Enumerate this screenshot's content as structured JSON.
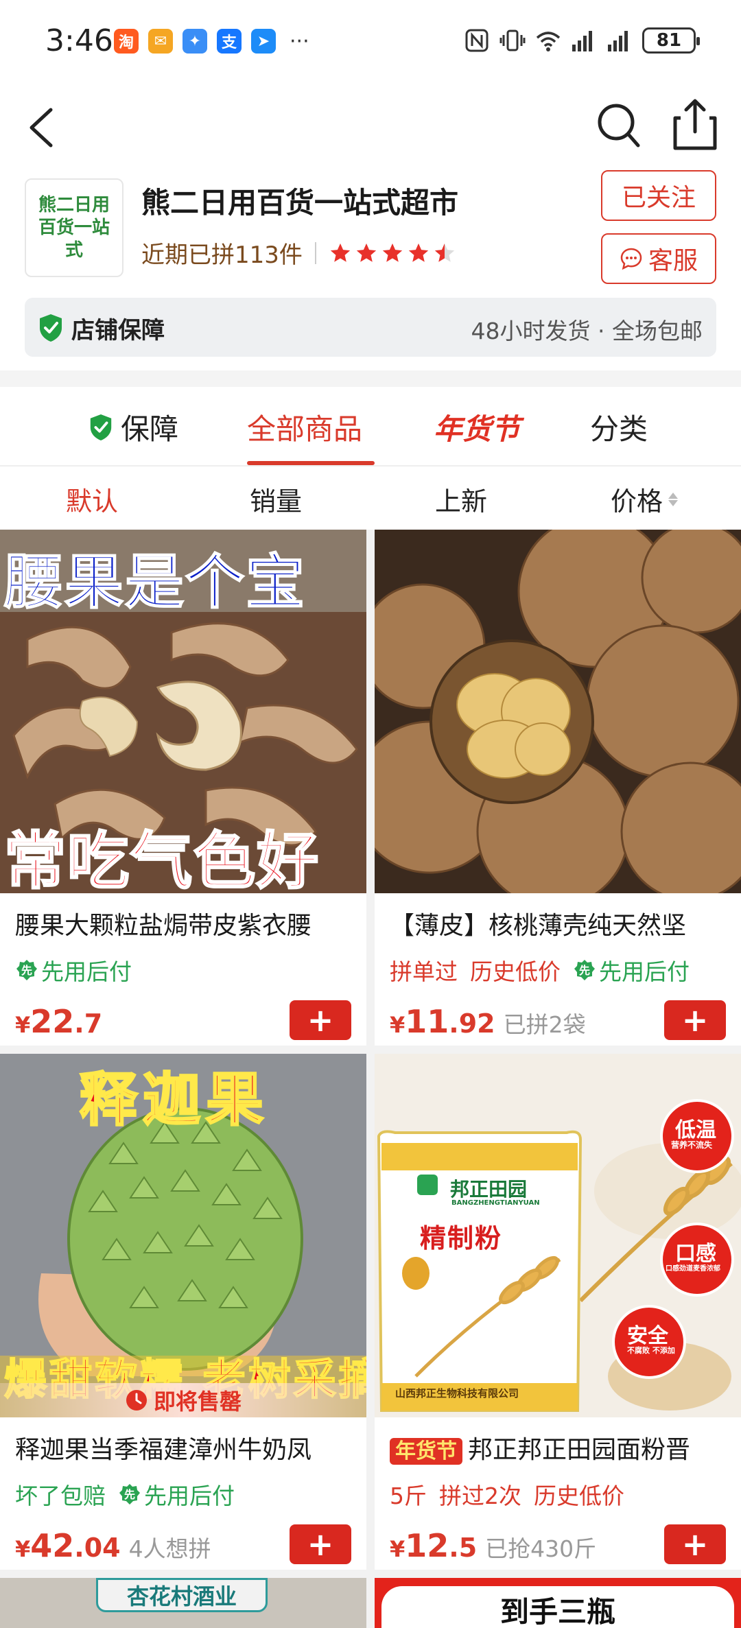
{
  "status_bar": {
    "time": "3:46",
    "more": "···",
    "battery": "81",
    "apps": [
      {
        "icon": "taobao-app-icon",
        "label": "淘",
        "color": "#ff5a1f"
      },
      {
        "icon": "mail-app-icon",
        "label": "✉",
        "color": "#f5a623"
      },
      {
        "icon": "pinwheel-app-icon",
        "label": "✦",
        "color": "#3a8ef6"
      },
      {
        "icon": "alipay-app-icon",
        "label": "支",
        "color": "#1677ff"
      },
      {
        "icon": "arrow-app-icon",
        "label": "➤",
        "color": "#1d8cf8"
      }
    ]
  },
  "shop": {
    "logo_text": "熊二日用百货一站式",
    "name": "熊二日用百货一站式超市",
    "recent_sales": "近期已拼113件",
    "rating_stars": 4.5,
    "follow_label": "已关注",
    "service_label": "客服",
    "guarantee_label": "店铺保障",
    "guarantee_info": "48小时发货 · 全场包邮"
  },
  "tabs": [
    {
      "label": "保障",
      "active": false
    },
    {
      "label": "全部商品",
      "active": true
    },
    {
      "label": "年货节",
      "active": false
    },
    {
      "label": "分类",
      "active": false
    }
  ],
  "sort": [
    {
      "label": "默认",
      "active": true
    },
    {
      "label": "销量",
      "active": false
    },
    {
      "label": "上新",
      "active": false
    },
    {
      "label": "价格",
      "active": false
    }
  ],
  "products": [
    {
      "title": "腰果大颗粒盐焗带皮紫衣腰",
      "image_top_text": "腰果是个宝",
      "image_bottom_text": "常吃气色好",
      "tags": [
        "先用后付"
      ],
      "price_symbol": "¥",
      "price_int": "22",
      "price_dec": ".7",
      "sold": ""
    },
    {
      "title": "【薄皮】核桃薄壳纯天然坚",
      "tags": [
        "拼单过",
        "历史低价",
        "先用后付"
      ],
      "price_symbol": "¥",
      "price_int": "11",
      "price_dec": ".92",
      "sold": "已拼2袋"
    },
    {
      "title": "释迦果当季福建漳州牛奶凤",
      "image_top_text": "释迦果",
      "image_bottom_text": "爆甜软糯 老树采摘",
      "soldout_label": "即将售罄",
      "tags": [
        "坏了包赔",
        "先用后付"
      ],
      "price_symbol": "¥",
      "price_int": "42",
      "price_dec": ".04",
      "sold": "4人想拼"
    },
    {
      "title": "邦正邦正田园面粉晋",
      "festival_badge": "年货节",
      "image_brand": "邦正田园",
      "image_brand_en": "BANGZHENGTIANYUAN",
      "image_product": "精制粉",
      "image_maker": "山西邦正生物科技有限公司",
      "image_badges": [
        "低温",
        "口感",
        "安全"
      ],
      "image_badge_subs": [
        "营养不流失",
        "口感劲道麦香浓郁",
        "不腐败 不添加"
      ],
      "tags": [
        "5斤",
        "拼过2次",
        "历史低价"
      ],
      "price_symbol": "¥",
      "price_int": "12",
      "price_dec": ".5",
      "sold": "已抢430斤"
    }
  ],
  "peek": {
    "left_banner": "杏花村酒业",
    "right_banner": "到手三瓶"
  },
  "add_label": "+"
}
